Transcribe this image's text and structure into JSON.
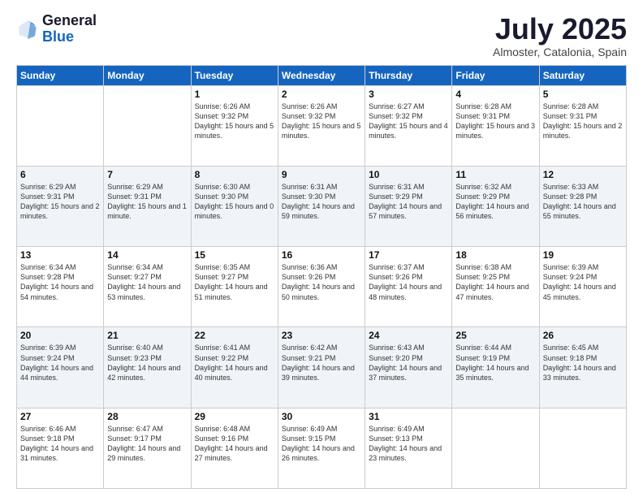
{
  "header": {
    "logo_general": "General",
    "logo_blue": "Blue",
    "title": "July 2025",
    "location": "Almoster, Catalonia, Spain"
  },
  "days_of_week": [
    "Sunday",
    "Monday",
    "Tuesday",
    "Wednesday",
    "Thursday",
    "Friday",
    "Saturday"
  ],
  "weeks": [
    [
      {
        "day": "",
        "info": ""
      },
      {
        "day": "",
        "info": ""
      },
      {
        "day": "1",
        "info": "Sunrise: 6:26 AM\nSunset: 9:32 PM\nDaylight: 15 hours and 5 minutes."
      },
      {
        "day": "2",
        "info": "Sunrise: 6:26 AM\nSunset: 9:32 PM\nDaylight: 15 hours and 5 minutes."
      },
      {
        "day": "3",
        "info": "Sunrise: 6:27 AM\nSunset: 9:32 PM\nDaylight: 15 hours and 4 minutes."
      },
      {
        "day": "4",
        "info": "Sunrise: 6:28 AM\nSunset: 9:31 PM\nDaylight: 15 hours and 3 minutes."
      },
      {
        "day": "5",
        "info": "Sunrise: 6:28 AM\nSunset: 9:31 PM\nDaylight: 15 hours and 2 minutes."
      }
    ],
    [
      {
        "day": "6",
        "info": "Sunrise: 6:29 AM\nSunset: 9:31 PM\nDaylight: 15 hours and 2 minutes."
      },
      {
        "day": "7",
        "info": "Sunrise: 6:29 AM\nSunset: 9:31 PM\nDaylight: 15 hours and 1 minute."
      },
      {
        "day": "8",
        "info": "Sunrise: 6:30 AM\nSunset: 9:30 PM\nDaylight: 15 hours and 0 minutes."
      },
      {
        "day": "9",
        "info": "Sunrise: 6:31 AM\nSunset: 9:30 PM\nDaylight: 14 hours and 59 minutes."
      },
      {
        "day": "10",
        "info": "Sunrise: 6:31 AM\nSunset: 9:29 PM\nDaylight: 14 hours and 57 minutes."
      },
      {
        "day": "11",
        "info": "Sunrise: 6:32 AM\nSunset: 9:29 PM\nDaylight: 14 hours and 56 minutes."
      },
      {
        "day": "12",
        "info": "Sunrise: 6:33 AM\nSunset: 9:28 PM\nDaylight: 14 hours and 55 minutes."
      }
    ],
    [
      {
        "day": "13",
        "info": "Sunrise: 6:34 AM\nSunset: 9:28 PM\nDaylight: 14 hours and 54 minutes."
      },
      {
        "day": "14",
        "info": "Sunrise: 6:34 AM\nSunset: 9:27 PM\nDaylight: 14 hours and 53 minutes."
      },
      {
        "day": "15",
        "info": "Sunrise: 6:35 AM\nSunset: 9:27 PM\nDaylight: 14 hours and 51 minutes."
      },
      {
        "day": "16",
        "info": "Sunrise: 6:36 AM\nSunset: 9:26 PM\nDaylight: 14 hours and 50 minutes."
      },
      {
        "day": "17",
        "info": "Sunrise: 6:37 AM\nSunset: 9:26 PM\nDaylight: 14 hours and 48 minutes."
      },
      {
        "day": "18",
        "info": "Sunrise: 6:38 AM\nSunset: 9:25 PM\nDaylight: 14 hours and 47 minutes."
      },
      {
        "day": "19",
        "info": "Sunrise: 6:39 AM\nSunset: 9:24 PM\nDaylight: 14 hours and 45 minutes."
      }
    ],
    [
      {
        "day": "20",
        "info": "Sunrise: 6:39 AM\nSunset: 9:24 PM\nDaylight: 14 hours and 44 minutes."
      },
      {
        "day": "21",
        "info": "Sunrise: 6:40 AM\nSunset: 9:23 PM\nDaylight: 14 hours and 42 minutes."
      },
      {
        "day": "22",
        "info": "Sunrise: 6:41 AM\nSunset: 9:22 PM\nDaylight: 14 hours and 40 minutes."
      },
      {
        "day": "23",
        "info": "Sunrise: 6:42 AM\nSunset: 9:21 PM\nDaylight: 14 hours and 39 minutes."
      },
      {
        "day": "24",
        "info": "Sunrise: 6:43 AM\nSunset: 9:20 PM\nDaylight: 14 hours and 37 minutes."
      },
      {
        "day": "25",
        "info": "Sunrise: 6:44 AM\nSunset: 9:19 PM\nDaylight: 14 hours and 35 minutes."
      },
      {
        "day": "26",
        "info": "Sunrise: 6:45 AM\nSunset: 9:18 PM\nDaylight: 14 hours and 33 minutes."
      }
    ],
    [
      {
        "day": "27",
        "info": "Sunrise: 6:46 AM\nSunset: 9:18 PM\nDaylight: 14 hours and 31 minutes."
      },
      {
        "day": "28",
        "info": "Sunrise: 6:47 AM\nSunset: 9:17 PM\nDaylight: 14 hours and 29 minutes."
      },
      {
        "day": "29",
        "info": "Sunrise: 6:48 AM\nSunset: 9:16 PM\nDaylight: 14 hours and 27 minutes."
      },
      {
        "day": "30",
        "info": "Sunrise: 6:49 AM\nSunset: 9:15 PM\nDaylight: 14 hours and 26 minutes."
      },
      {
        "day": "31",
        "info": "Sunrise: 6:49 AM\nSunset: 9:13 PM\nDaylight: 14 hours and 23 minutes."
      },
      {
        "day": "",
        "info": ""
      },
      {
        "day": "",
        "info": ""
      }
    ]
  ]
}
